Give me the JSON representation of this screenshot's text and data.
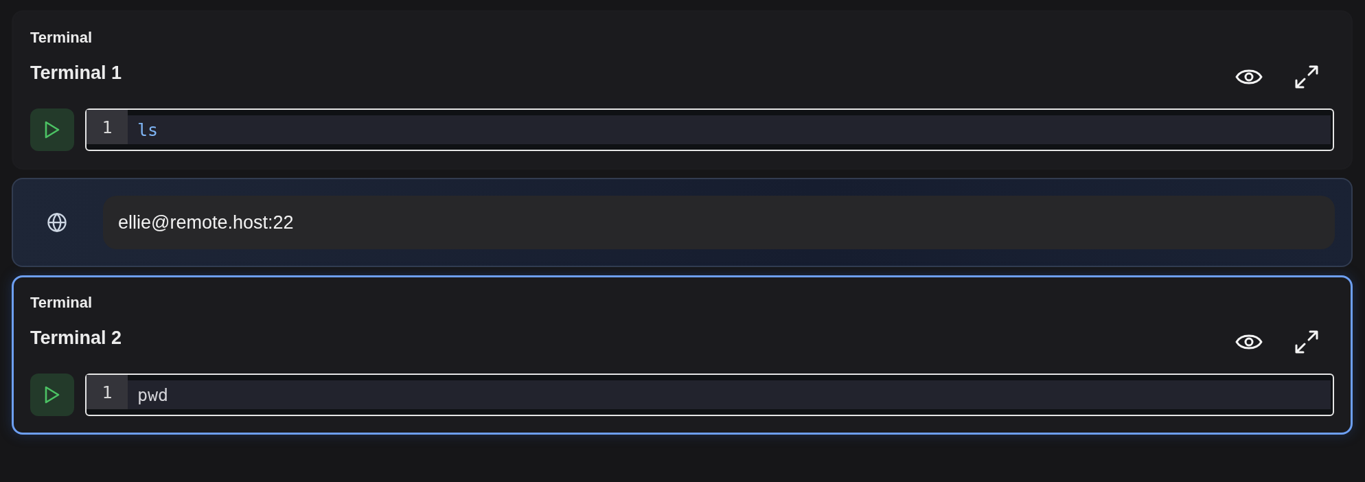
{
  "cards": [
    {
      "kind": "terminal",
      "selected": false,
      "label": "Terminal",
      "title": "Terminal 1",
      "line_number": "1",
      "code": "ls",
      "highlighted": true
    },
    {
      "kind": "connection",
      "value": "ellie@remote.host:22"
    },
    {
      "kind": "terminal",
      "selected": true,
      "label": "Terminal",
      "title": "Terminal 2",
      "line_number": "1",
      "code": "pwd",
      "highlighted": false
    }
  ]
}
